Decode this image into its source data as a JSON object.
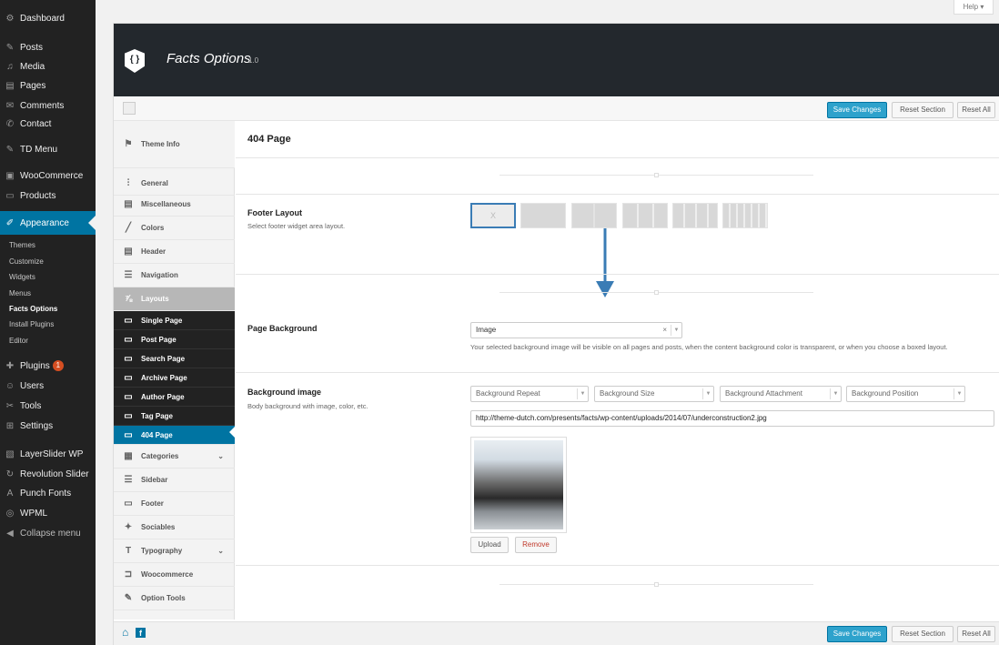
{
  "wp_menu": {
    "items": [
      {
        "icon": "dashboard-icon",
        "glyph": "⚙",
        "label": "Dashboard"
      },
      {
        "icon": "pin-icon",
        "glyph": "✎",
        "label": "Posts"
      },
      {
        "icon": "media-icon",
        "glyph": "♫",
        "label": "Media"
      },
      {
        "icon": "pages-icon",
        "glyph": "▤",
        "label": "Pages"
      },
      {
        "icon": "comments-icon",
        "glyph": "✉",
        "label": "Comments"
      },
      {
        "icon": "contact-icon",
        "glyph": "✆",
        "label": "Contact"
      },
      {
        "icon": "pin-icon",
        "glyph": "✎",
        "label": "TD Menu"
      },
      {
        "icon": "woocommerce-icon",
        "glyph": "▣",
        "label": "WooCommerce"
      },
      {
        "icon": "products-icon",
        "glyph": "▭",
        "label": "Products"
      },
      {
        "icon": "appearance-icon",
        "glyph": "✐",
        "label": "Appearance"
      }
    ],
    "appearance_sub": [
      "Themes",
      "Customize",
      "Widgets",
      "Menus",
      "Facts Options",
      "Install Plugins",
      "Editor"
    ],
    "items_after": [
      {
        "icon": "plugins-icon",
        "glyph": "✚",
        "label": "Plugins",
        "badge": "1"
      },
      {
        "icon": "users-icon",
        "glyph": "☺",
        "label": "Users"
      },
      {
        "icon": "tools-icon",
        "glyph": "✂",
        "label": "Tools"
      },
      {
        "icon": "settings-icon",
        "glyph": "⊞",
        "label": "Settings"
      },
      {
        "icon": "layerslider-icon",
        "glyph": "▧",
        "label": "LayerSlider WP"
      },
      {
        "icon": "revolution-icon",
        "glyph": "↻",
        "label": "Revolution Slider"
      },
      {
        "icon": "fonts-icon",
        "glyph": "A",
        "label": "Punch Fonts"
      },
      {
        "icon": "wpml-icon",
        "glyph": "◎",
        "label": "WPML"
      },
      {
        "icon": "collapse-icon",
        "glyph": "◀",
        "label": "Collapse menu"
      }
    ]
  },
  "help_tab": "Help ▾",
  "header": {
    "logo_glyph": "{ }",
    "title": "Facts Options",
    "version": "1.0"
  },
  "toolbar": {
    "save": "Save Changes",
    "reset_section": "Reset Section",
    "reset_all": "Reset All"
  },
  "sidebar": {
    "theme_info": "Theme Info",
    "general": "General",
    "misc": "Miscellaneous",
    "colors": "Colors",
    "header": "Header",
    "navigation": "Navigation",
    "layouts": "Layouts",
    "layout_subs": [
      "Single Page",
      "Post Page",
      "Search Page",
      "Archive Page",
      "Author Page",
      "Tag Page",
      "404 Page"
    ],
    "categories": "Categories",
    "sidebar": "Sidebar",
    "footer": "Footer",
    "sociables": "Sociables",
    "typography": "Typography",
    "woocommerce": "Woocommerce",
    "option_tools": "Option Tools"
  },
  "section_title": "404 Page",
  "footer_layout": {
    "label": "Footer Layout",
    "desc": "Select footer widget area layout.",
    "selected_glyph": "X"
  },
  "page_background": {
    "label": "Page Background",
    "value": "Image",
    "clear": "×",
    "note": "Your selected background image will be visible on all pages and posts, when the content background color is transparent, or when you choose a boxed layout."
  },
  "background_image": {
    "label": "Background image",
    "desc": "Body background with image, color, etc.",
    "selects": [
      "Background Repeat",
      "Background Size",
      "Background Attachment",
      "Background Position"
    ],
    "url": "http://theme-dutch.com/presents/facts/wp-content/uploads/2014/07/underconstruction2.jpg",
    "upload": "Upload",
    "remove": "Remove"
  },
  "footer": {
    "home_glyph": "⌂",
    "fb_glyph": "f"
  }
}
